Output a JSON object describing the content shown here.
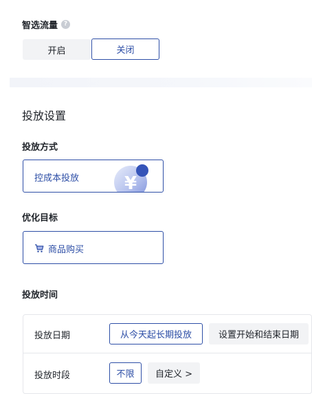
{
  "smart_traffic": {
    "title": "智选流量",
    "help_icon": "question-circle-icon",
    "options": {
      "on_label": "开启",
      "off_label": "关闭"
    },
    "selected": "关闭"
  },
  "delivery_settings": {
    "title": "投放设置",
    "method": {
      "label": "投放方式",
      "value": "控成本投放",
      "icon": "yuan-coin-icon"
    },
    "goal": {
      "label": "优化目标",
      "value": "商品购买",
      "icon": "shopping-cart-icon"
    },
    "time": {
      "label": "投放时间",
      "date": {
        "label": "投放日期",
        "selected_option": "从今天起长期投放",
        "other_option": "设置开始和结束日期"
      },
      "period": {
        "label": "投放时段",
        "selected_option": "不限",
        "custom_option": "自定义 >"
      }
    }
  },
  "colors": {
    "accent": "#2d4ea6",
    "text": "#1f2329",
    "muted_bg": "#f2f3f5",
    "border": "#e5e6eb"
  }
}
